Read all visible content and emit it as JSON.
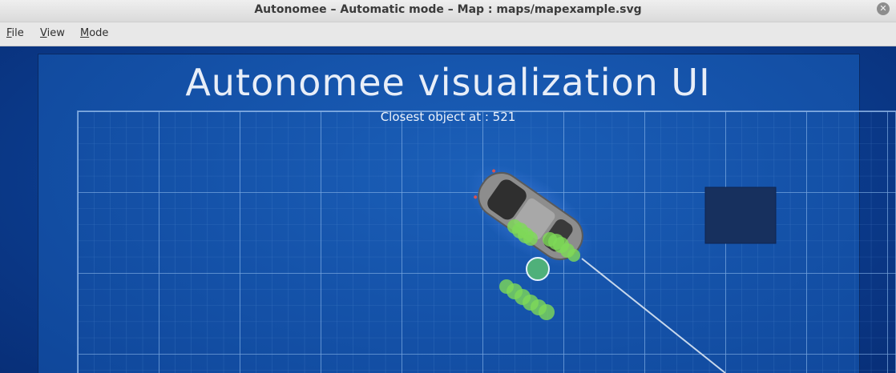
{
  "window": {
    "title": "Autonomee – Automatic mode – Map : maps/mapexample.svg",
    "close_glyph": "✕"
  },
  "menu": {
    "items": [
      {
        "label": "File",
        "accel": "F",
        "rest": "ile"
      },
      {
        "label": "View",
        "accel": "V",
        "rest": "iew"
      },
      {
        "label": "Mode",
        "accel": "M",
        "rest": "ode"
      }
    ]
  },
  "viz": {
    "title": "Autonomee visualization UI",
    "closest_object_text": "Closest object at : 521"
  },
  "icons": {
    "close": "close-icon",
    "car": "car-icon"
  },
  "colors": {
    "background": "#0c3a8a",
    "grid": "#6ea3e0",
    "obstacle": "#17305e",
    "sensor_dots": "#7ed957",
    "car": "#8a8a8a"
  }
}
